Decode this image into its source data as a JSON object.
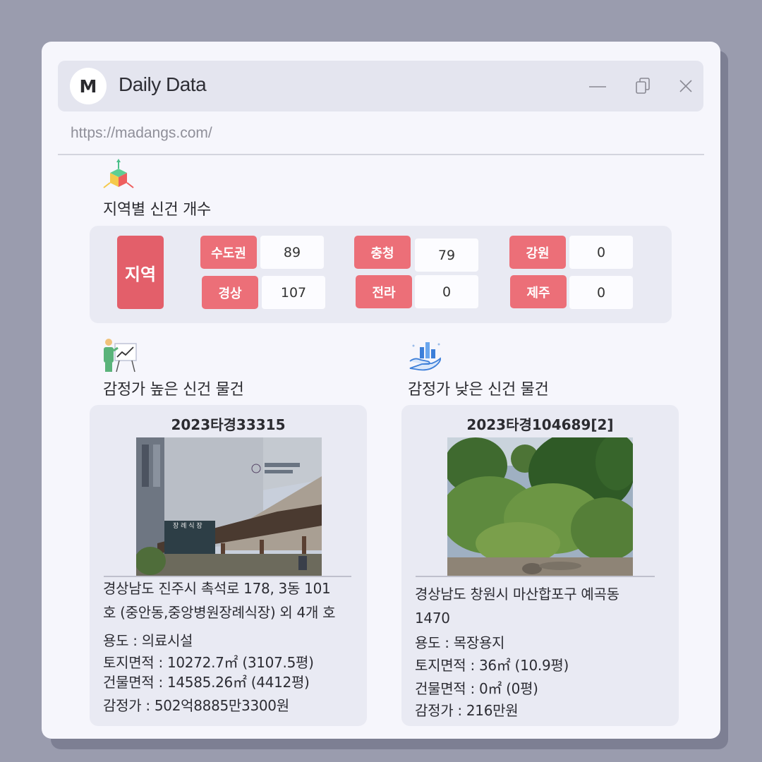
{
  "app": {
    "logo_letter": "M",
    "title": "Daily Data",
    "url": "https://madangs.com/"
  },
  "window_controls": {
    "minimize": "minimize-icon",
    "restore": "restore-icon",
    "close": "close-icon"
  },
  "regions_section": {
    "icon": "3d-cube-icon",
    "title": "지역별 신건 개수",
    "main_label": "지역",
    "items": [
      {
        "label": "수도권",
        "value": "89"
      },
      {
        "label": "경상",
        "value": "107"
      },
      {
        "label": "충청",
        "value": "79"
      },
      {
        "label": "전라",
        "value": "0"
      },
      {
        "label": "강원",
        "value": "0"
      },
      {
        "label": "제주",
        "value": "0"
      }
    ]
  },
  "high_section": {
    "icon": "presentation-chart-icon",
    "title": "감정가 높은 신건 물건",
    "case_no": "2023타경33315",
    "photo": "funeral-hall-building-photo",
    "address_line1": "경상남도 진주시 촉석로 178, 3동 101",
    "address_line2": "호 (중안동,중앙병원장례식장) 외 4개 호",
    "usage": "용도 : 의료시설",
    "land_area": "토지면적 : 10272.7㎡ (3107.5평)",
    "building_area": "건물면적 : 14585.26㎡ (4412평)",
    "appraisal": "감정가 : 502억8885만3300원"
  },
  "low_section": {
    "icon": "hand-chart-icon",
    "title": "감정가 낮은 신건 물건",
    "case_no": "2023타경104689[2]",
    "photo": "forest-land-photo",
    "address_line1": "경상남도 창원시 마산합포구 예곡동",
    "address_line2": "1470",
    "usage": "용도 :  목장용지",
    "land_area": "토지면적 : 36㎡ (10.9평)",
    "building_area": "건물면적 : 0㎡ (0평)",
    "appraisal": "감정가 : 216만원"
  }
}
